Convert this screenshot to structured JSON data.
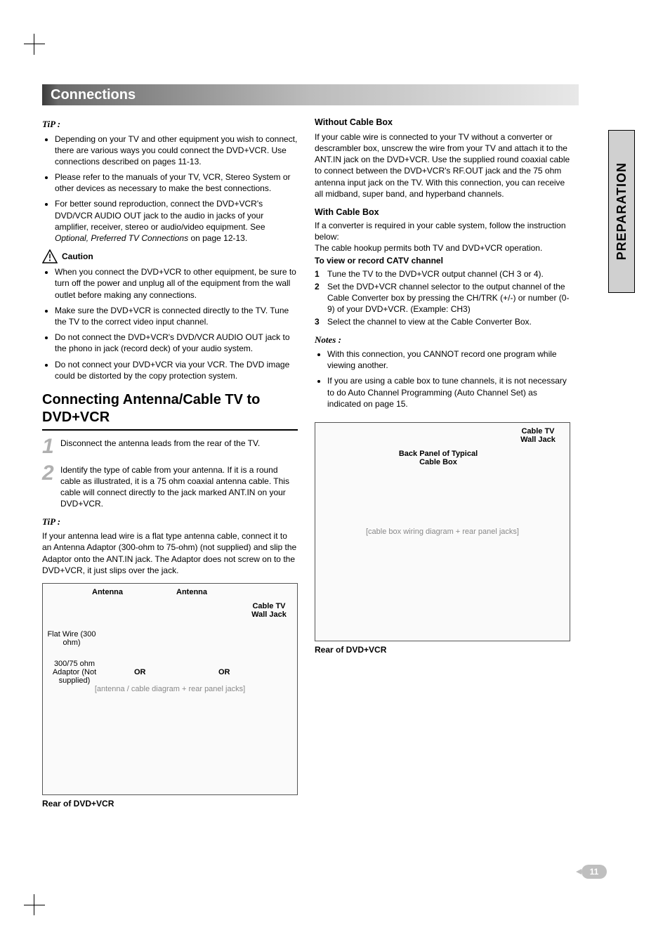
{
  "side_tab": "PREPARATION",
  "header": "Connections",
  "page_number": "11",
  "left": {
    "tip_label": "TiP :",
    "tips": [
      "Depending on your TV and other equipment you wish to connect, there are various ways you could connect the DVD+VCR. Use connections described on pages 11-13.",
      "Please refer to the manuals of your TV, VCR, Stereo System or other devices as necessary to make the best connections.",
      "For better sound reproduction, connect the DVD+VCR's DVD/VCR AUDIO OUT jack to the audio in jacks of your amplifier, receiver, stereo or audio/video equipment. See Optional, Preferred TV Connections on page 12-13."
    ],
    "caution_label": "Caution",
    "cautions": [
      "When you connect the DVD+VCR to other equipment, be sure to turn off the power and unplug all of the equipment from the wall outlet before making any connections.",
      "Make sure the DVD+VCR is connected directly to the TV. Tune the TV to the correct video input channel.",
      "Do not connect the DVD+VCR's DVD/VCR AUDIO OUT jack to the phono in jack (record deck) of your audio system.",
      "Do not connect your DVD+VCR via your VCR. The DVD image could be distorted by the copy protection system."
    ],
    "section_title": "Connecting Antenna/Cable TV to DVD+VCR",
    "steps": [
      {
        "n": "1",
        "text": "Disconnect the antenna leads from the rear of the TV."
      },
      {
        "n": "2",
        "text": "Identify the type of cable from your antenna. If it is a round cable as illustrated, it is a 75 ohm coaxial antenna cable. This cable will connect directly to the jack marked ANT.IN on your DVD+VCR."
      }
    ],
    "tip2_label": "TiP :",
    "tip2_text": "If your antenna lead wire is a flat type antenna cable, connect it to an Antenna Adaptor (300-ohm to 75-ohm) (not supplied) and slip the Adaptor onto the ANT.IN jack. The Adaptor does not screw on to the DVD+VCR, it just slips over the jack.",
    "fig": {
      "antenna_a": "Antenna",
      "antenna_b": "Antenna",
      "cable_wall": "Cable TV Wall Jack",
      "flat_wire": "Flat Wire (300 ohm)",
      "adaptor": "300/75 ohm Adaptor (Not supplied)",
      "or": "OR",
      "caption": "Rear of DVD+VCR"
    }
  },
  "right": {
    "without_title": "Without Cable Box",
    "without_text": "If your cable wire is connected to your TV without a converter or descrambler box, unscrew the wire from your TV and attach it to the ANT.IN jack on the DVD+VCR. Use the supplied round coaxial cable to connect between the DVD+VCR's RF.OUT jack and the 75 ohm antenna input jack on the TV. With this connection, you can receive all midband, super band, and hyperband channels.",
    "with_title": "With Cable Box",
    "with_text1": "If a converter is required in your cable system, follow the instruction below:",
    "with_text2": "The cable hookup permits both TV and DVD+VCR operation.",
    "with_sub": "To view or record CATV channel",
    "with_steps": [
      {
        "n": "1",
        "text": "Tune the TV to the DVD+VCR output channel (CH 3 or 4)."
      },
      {
        "n": "2",
        "text": "Set the DVD+VCR channel selector to the output channel of the Cable Converter box by pressing the CH/TRK (+/-) or number (0-9) of your DVD+VCR. (Example: CH3)"
      },
      {
        "n": "3",
        "text": "Select the channel to view at the Cable Converter Box."
      }
    ],
    "notes_label": "Notes :",
    "notes": [
      "With this connection, you CANNOT record one program while viewing another.",
      "If you are using a cable box to tune channels, it is not necessary to do Auto Channel Programming (Auto Channel Set) as indicated on page 15."
    ],
    "fig": {
      "wall": "Cable TV Wall Jack",
      "box": "Back Panel of Typical Cable Box",
      "caption": "Rear of DVD+VCR"
    }
  }
}
